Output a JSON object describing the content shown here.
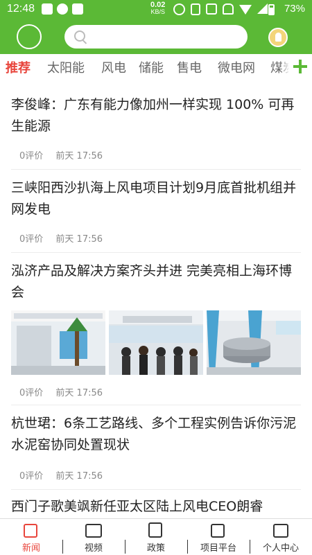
{
  "status_bar": {
    "time": "12:48",
    "network_speed_value": "0.02",
    "network_speed_unit": "KB/S",
    "battery": "73%",
    "battery_level": 0.73,
    "left_icons": [
      "mail-icon",
      "app-notification-icon",
      "image-icon"
    ],
    "right_icons": [
      "alarm-icon",
      "vibrate-icon",
      "nfc-icon",
      "mute-icon",
      "wifi-icon",
      "signal-icon",
      "battery-icon"
    ]
  },
  "header": {
    "logo_icon": "app-logo-icon",
    "search": {
      "value": "",
      "placeholder": ""
    },
    "avatar_icon": "user-avatar-icon"
  },
  "tabs": [
    {
      "label": "推荐",
      "active": true
    },
    {
      "label": "太阳能",
      "active": false
    },
    {
      "label": "风电",
      "active": false
    },
    {
      "label": "储能",
      "active": false
    },
    {
      "label": "售电",
      "active": false
    },
    {
      "label": "微电网",
      "active": false
    },
    {
      "label": "煤炭",
      "active": false
    }
  ],
  "tab_add_icon": "plus-icon",
  "articles": [
    {
      "title": "李俊峰：广东有能力像加州一样实现 100% 可再生能源",
      "comments": "0评价",
      "time": "前天 17:56"
    },
    {
      "title": "三峡阳西沙扒海上风电项目计划9月底首批机组并网发电",
      "comments": "0评价",
      "time": "前天 17:56"
    },
    {
      "title": "泓济产品及解决方案齐头并进 完美亮相上海环博会",
      "comments": "0评价",
      "time": "前天 17:56",
      "has_images": true
    },
    {
      "title": "杭世珺：6条工艺路线、多个工程实例告诉你污泥水泥窑协同处置现状",
      "comments": "0评价",
      "time": "前天 17:56"
    },
    {
      "title": "西门子歌美飒新任亚太区陆上风电CEO朗睿",
      "comments": "",
      "time": ""
    }
  ],
  "bottom_nav": [
    {
      "label": "新闻",
      "icon": "news-icon",
      "active": true
    },
    {
      "label": "视频",
      "icon": "video-icon",
      "active": false
    },
    {
      "label": "政策",
      "icon": "policy-document-icon",
      "active": false
    },
    {
      "label": "项目平台",
      "icon": "project-platform-icon",
      "active": false
    },
    {
      "label": "个人中心",
      "icon": "profile-icon",
      "active": false
    }
  ],
  "colors": {
    "brand_green": "#5bb936",
    "active_red": "#e8453c"
  }
}
